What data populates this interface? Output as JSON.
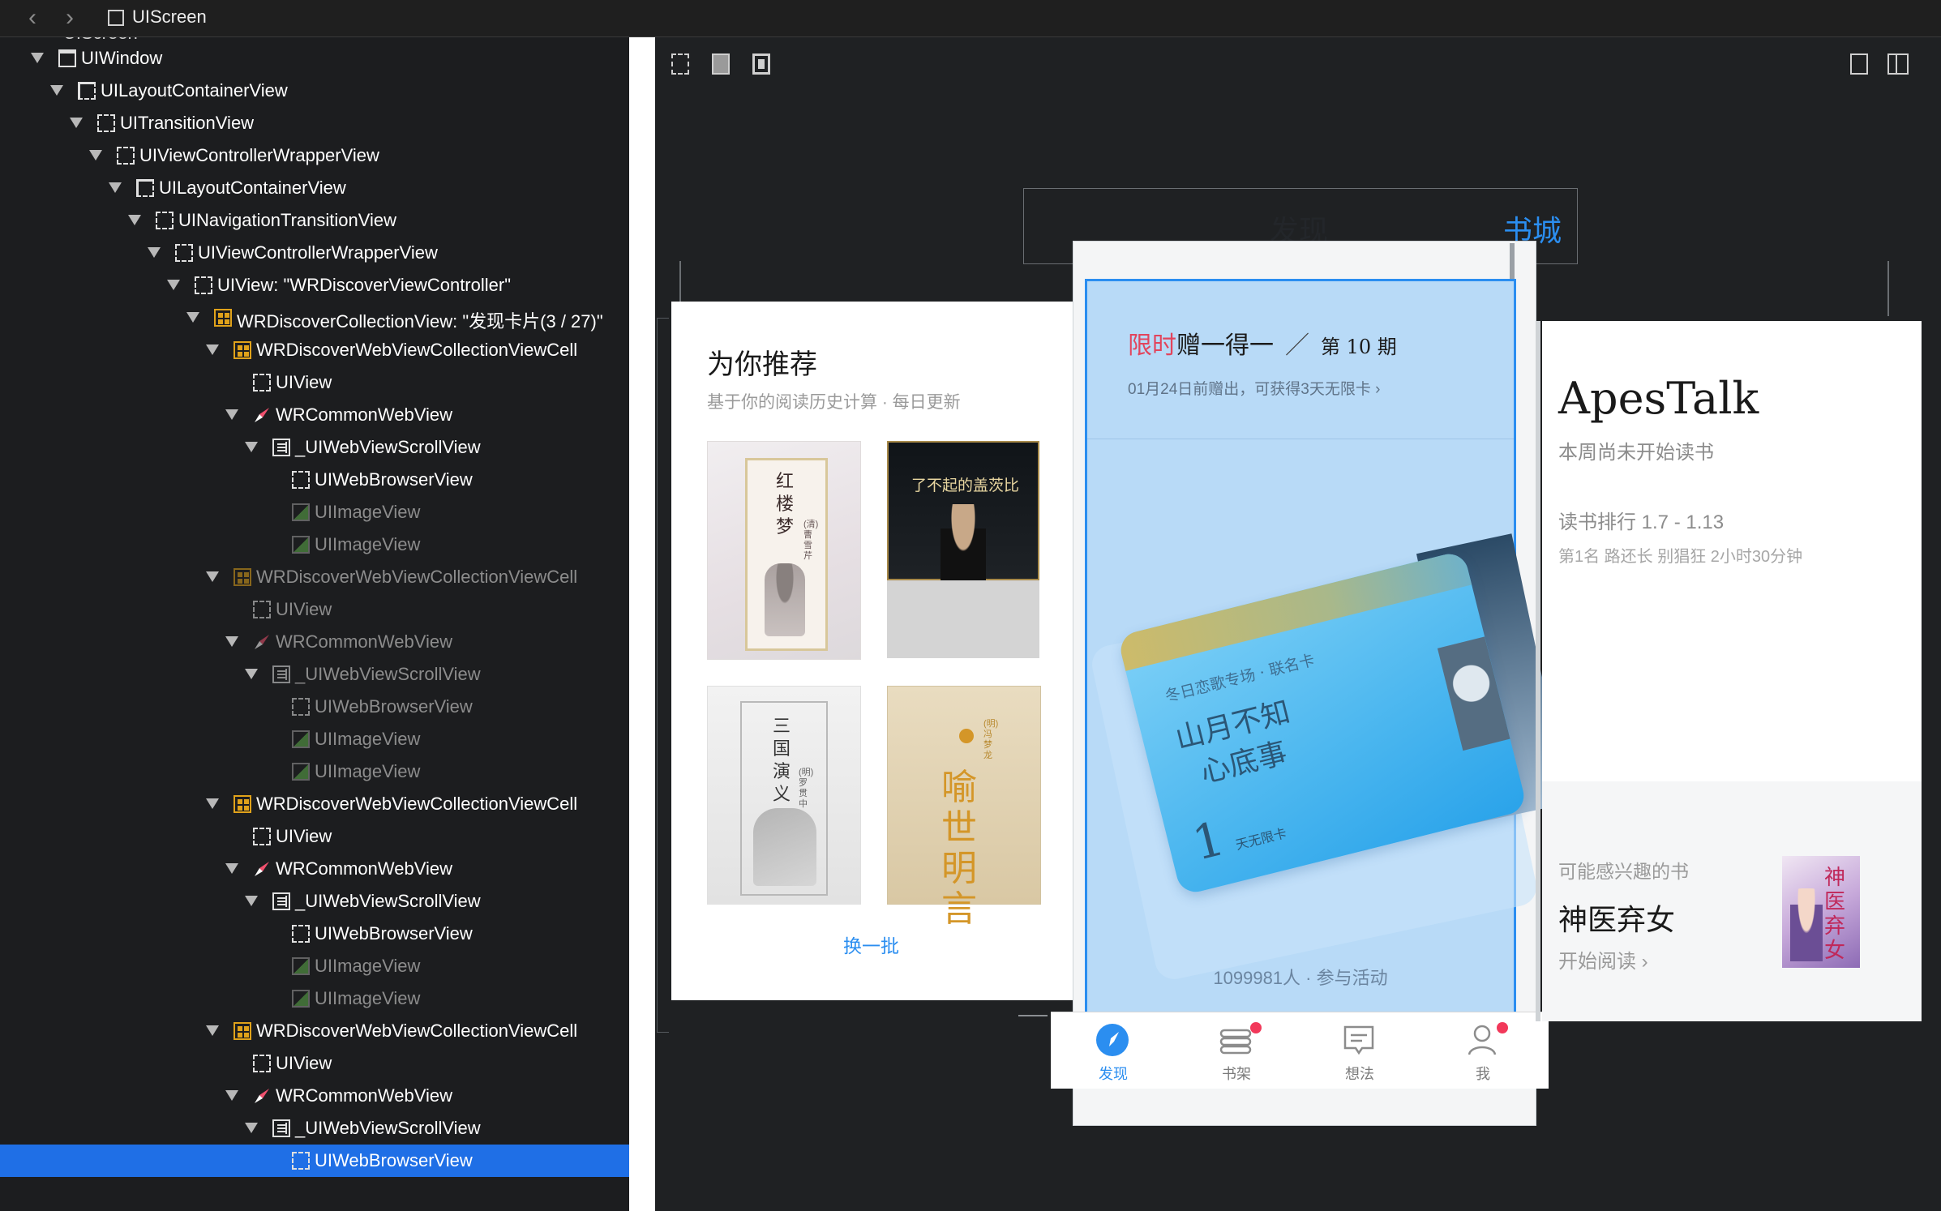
{
  "topbar": {
    "back_label": "‹",
    "forward_label": "›",
    "title": "UIScreen"
  },
  "tree": {
    "partial_top_label": "UIScreen",
    "rows": [
      {
        "label": "UIWindow",
        "icon": "window-icon",
        "level": 0,
        "expanded": true
      },
      {
        "label": "UILayoutContainerView",
        "icon": "layout-container-icon",
        "level": 1,
        "expanded": true
      },
      {
        "label": "UITransitionView",
        "icon": "view-icon",
        "level": 2,
        "expanded": true
      },
      {
        "label": "UIViewControllerWrapperView",
        "icon": "view-icon",
        "level": 3,
        "expanded": true
      },
      {
        "label": "UILayoutContainerView",
        "icon": "layout-container-icon",
        "level": 4,
        "expanded": true
      },
      {
        "label": "UINavigationTransitionView",
        "icon": "view-icon",
        "level": 5,
        "expanded": true
      },
      {
        "label": "UIViewControllerWrapperView",
        "icon": "view-icon",
        "level": 6,
        "expanded": true
      },
      {
        "label": "UIView: \"WRDiscoverViewController\"",
        "icon": "view-icon",
        "level": 7,
        "expanded": true
      },
      {
        "label": "WRDiscoverCollectionView: \"发现卡片(3 / 27)\"",
        "icon": "collection-view-icon",
        "level": 8,
        "expanded": true
      },
      {
        "label": "WRDiscoverWebViewCollectionViewCell",
        "icon": "collection-cell-icon",
        "level": 9,
        "expanded": true
      },
      {
        "label": "UIView",
        "icon": "view-icon",
        "level": 10,
        "expanded": false
      },
      {
        "label": "WRCommonWebView",
        "icon": "compass-icon",
        "level": 10,
        "expanded": true
      },
      {
        "label": "_UIWebViewScrollView",
        "icon": "scroll-view-icon",
        "level": 11,
        "expanded": true
      },
      {
        "label": "UIWebBrowserView",
        "icon": "view-icon",
        "level": 12,
        "expanded": false
      },
      {
        "label": "UIImageView",
        "icon": "image-view-icon",
        "level": 12,
        "expanded": false,
        "dim": true
      },
      {
        "label": "UIImageView",
        "icon": "image-view-icon",
        "level": 12,
        "expanded": false,
        "dim": true
      },
      {
        "label": "WRDiscoverWebViewCollectionViewCell",
        "icon": "collection-cell-icon",
        "level": 9,
        "expanded": true,
        "dim": true
      },
      {
        "label": "UIView",
        "icon": "view-icon",
        "level": 10,
        "expanded": false,
        "dim": true
      },
      {
        "label": "WRCommonWebView",
        "icon": "compass-icon",
        "level": 10,
        "expanded": true,
        "dim": true
      },
      {
        "label": "_UIWebViewScrollView",
        "icon": "scroll-view-icon",
        "level": 11,
        "expanded": true,
        "dim": true
      },
      {
        "label": "UIWebBrowserView",
        "icon": "view-icon",
        "level": 12,
        "expanded": false,
        "dim": true
      },
      {
        "label": "UIImageView",
        "icon": "image-view-icon",
        "level": 12,
        "expanded": false,
        "dim": true
      },
      {
        "label": "UIImageView",
        "icon": "image-view-icon",
        "level": 12,
        "expanded": false,
        "dim": true
      },
      {
        "label": "WRDiscoverWebViewCollectionViewCell",
        "icon": "collection-cell-icon",
        "level": 9,
        "expanded": true
      },
      {
        "label": "UIView",
        "icon": "view-icon",
        "level": 10,
        "expanded": false
      },
      {
        "label": "WRCommonWebView",
        "icon": "compass-icon",
        "level": 10,
        "expanded": true
      },
      {
        "label": "_UIWebViewScrollView",
        "icon": "scroll-view-icon",
        "level": 11,
        "expanded": true
      },
      {
        "label": "UIWebBrowserView",
        "icon": "view-icon",
        "level": 12,
        "expanded": false
      },
      {
        "label": "UIImageView",
        "icon": "image-view-icon",
        "level": 12,
        "expanded": false,
        "dim": true
      },
      {
        "label": "UIImageView",
        "icon": "image-view-icon",
        "level": 12,
        "expanded": false,
        "dim": true
      },
      {
        "label": "WRDiscoverWebViewCollectionViewCell",
        "icon": "collection-cell-icon",
        "level": 9,
        "expanded": true
      },
      {
        "label": "UIView",
        "icon": "view-icon",
        "level": 10,
        "expanded": false
      },
      {
        "label": "WRCommonWebView",
        "icon": "compass-icon",
        "level": 10,
        "expanded": true
      },
      {
        "label": "_UIWebViewScrollView",
        "icon": "scroll-view-icon",
        "level": 11,
        "expanded": true
      },
      {
        "label": "UIWebBrowserView",
        "icon": "view-icon",
        "level": 12,
        "expanded": false,
        "selected": true
      }
    ]
  },
  "canvas": {
    "toolbar_left": [
      "frame-icon",
      "fill-icon",
      "bounds-icon"
    ],
    "toolbar_right": [
      "single-panel-icon",
      "split-panel-icon"
    ],
    "nav": {
      "discover": "发现",
      "bookstore": "书城"
    },
    "left_card": {
      "title": "为你推荐",
      "subtitle": "基于你的阅读历史计算 · 每日更新",
      "books": [
        {
          "title": "红楼梦",
          "author": "(清)曹雪芹"
        },
        {
          "title": "了不起的盖茨比",
          "author": ""
        },
        {
          "title": "三国演义",
          "author": "(明)罗贯中"
        },
        {
          "title": "喻世明言",
          "author": "(明)冯梦龙"
        }
      ],
      "refresh": "换一批"
    },
    "mid_card": {
      "title_highlight": "限时",
      "title_rest": "赠一得一",
      "issue": "第 10 期",
      "desc": "01月24日前赠出，可获得3天无限卡",
      "card_top": "冬日恋歌专场 · 联名卡",
      "card_title_1": "山月不知",
      "card_title_2": "心底事",
      "card_num": "1",
      "card_unit": "天无限卡",
      "participants": "1099981人 · 参与活动"
    },
    "right_card": {
      "name": "ApesTalk",
      "status": "本周尚未开始读书",
      "rank_title": "读书排行 1.7 - 1.13",
      "rank_detail": "第1名 路还长 别猖狂 2小时30分钟",
      "maybe": "可能感兴趣的书",
      "book": "神医弃女",
      "start": "开始阅读",
      "cover_title": "神医弃女"
    },
    "tabs": [
      {
        "label": "发现",
        "icon": "compass-icon",
        "active": true
      },
      {
        "label": "书架",
        "icon": "bookshelf-icon",
        "badge": true
      },
      {
        "label": "想法",
        "icon": "comment-icon"
      },
      {
        "label": "我",
        "icon": "person-icon",
        "badge": true
      }
    ]
  },
  "colors": {
    "selection": "#1f6fe6",
    "accent_blue": "#2b8ef0",
    "highlight_red": "#e2445c",
    "badge_red": "#f2385a"
  }
}
